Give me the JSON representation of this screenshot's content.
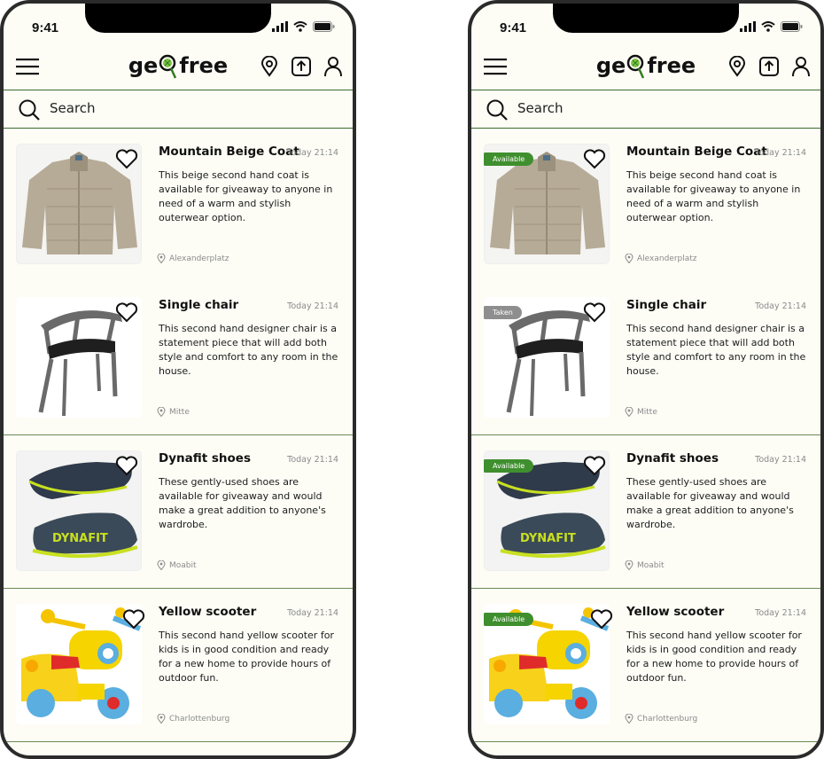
{
  "status": {
    "time": "9:41"
  },
  "app": {
    "logo_text_left": "ge",
    "logo_text_right": "free"
  },
  "search": {
    "label": "Search"
  },
  "items": [
    {
      "title": "Mountain Beige Coat",
      "date": "Today 21:14",
      "description": "This beige second hand coat is available for giveaway to anyone in need of a warm and stylish outerwear option.",
      "location": "Alexanderplatz",
      "status": "Available",
      "image": "beige-coat"
    },
    {
      "title": "Single chair",
      "date": "Today 21:14",
      "description": "This second hand designer chair is a statement piece that will add both style and comfort to any room in the house.",
      "location": "Mitte",
      "status": "Taken",
      "image": "designer-chair"
    },
    {
      "title": "Dynafit shoes",
      "date": "Today 21:14",
      "description": "These gently-used shoes are available for giveaway and would make a great addition to anyone's wardrobe.",
      "location": "Moabit",
      "status": "Available",
      "image": "dynafit-shoes",
      "brand_print": "DYNAFIT"
    },
    {
      "title": "Yellow scooter",
      "date": "Today 21:14",
      "description": "This second hand yellow scooter for kids is in good condition and ready for a new home to provide hours of outdoor fun.",
      "location": "Charlottenburg",
      "status": "Available",
      "image": "yellow-scooter"
    }
  ],
  "colors": {
    "accent": "#3f8f2e",
    "divider": "#3b6b2c",
    "background": "#fdfdf6",
    "taken": "#8e8e8e"
  }
}
